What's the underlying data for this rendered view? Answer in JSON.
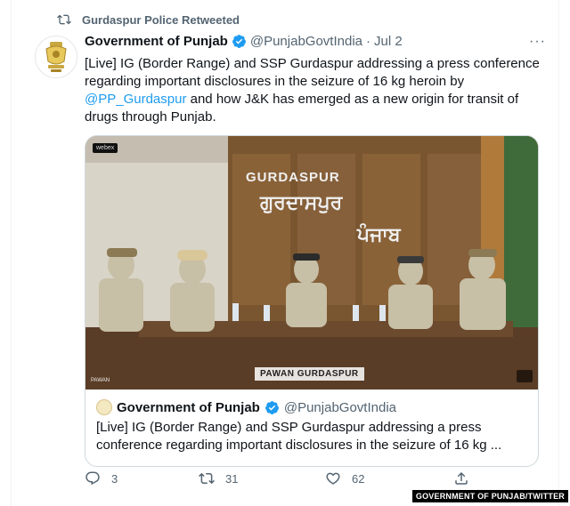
{
  "retweet": {
    "label": "Gurdaspur Police Retweeted"
  },
  "tweet": {
    "name": "Government of Punjab",
    "handle": "@PunjabGovtIndia",
    "separator": "·",
    "date": "Jul 2",
    "more": "···",
    "text_part1": "[Live] IG (Border Range) and SSP Gurdaspur addressing a press conference regarding important disclosures in the seizure of 16 kg heroin by ",
    "mention": "@PP_Gurdaspur",
    "text_part2": " and how J&K has emerged as a new origin for transit of drugs through Punjab."
  },
  "video": {
    "webex_label": "webex",
    "sign_english": "GURDASPUR",
    "sign_punjabi_line1": "ਗੁਰਦਾਸਪੁਰ",
    "sign_punjabi_line2": "ਪੰਜਾਬ",
    "nameplate": "PAWAN GURDASPUR",
    "corner_label": "PAWAN"
  },
  "quote": {
    "name": "Government of Punjab",
    "handle": "@PunjabGovtIndia",
    "text": "[Live] IG (Border Range) and SSP Gurdaspur addressing a press conference regarding important disclosures in the seizure of 16 kg ..."
  },
  "actions": {
    "reply_count": "3",
    "retweet_count": "31",
    "like_count": "62"
  },
  "watermark": "GOVERNMENT OF PUNJAB/TWITTER",
  "colors": {
    "accent": "#1d9bf0",
    "muted": "#536471",
    "text": "#0f1419"
  }
}
